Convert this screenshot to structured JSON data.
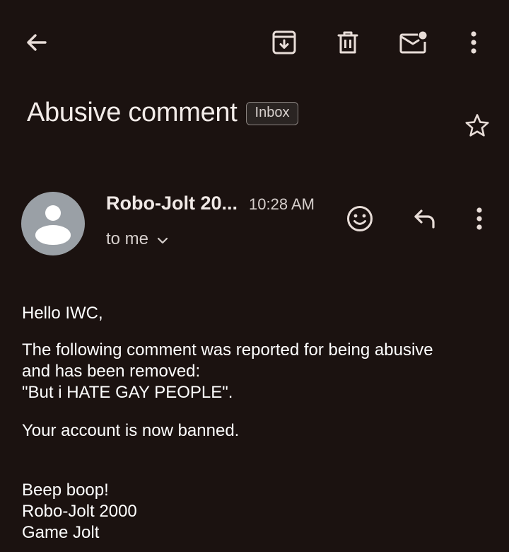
{
  "toolbar": {
    "back": "arrow-back-icon",
    "archive": "archive-icon",
    "delete": "trash-icon",
    "mark_unread": "mark-unread-icon",
    "more": "more-vertical-icon"
  },
  "email": {
    "subject": "Abusive comment",
    "label": "Inbox",
    "sender_name": "Robo-Jolt 20...",
    "time": "10:28 AM",
    "recipient": "to me",
    "body": {
      "greeting": "Hello IWC,",
      "line1": "The following comment was reported for being abusive",
      "line2": "and has been removed:",
      "quote": "\"But i HATE GAY PEOPLE\".",
      "ban": "Your account is now banned.",
      "sign1": "Beep boop!",
      "sign2": "Robo-Jolt 2000",
      "sign3": "Game Jolt"
    }
  },
  "colors": {
    "background": "#1b1210",
    "icon": "#e8ddd8",
    "avatar": "#9aa0a6",
    "chip_border": "#8a8380"
  }
}
